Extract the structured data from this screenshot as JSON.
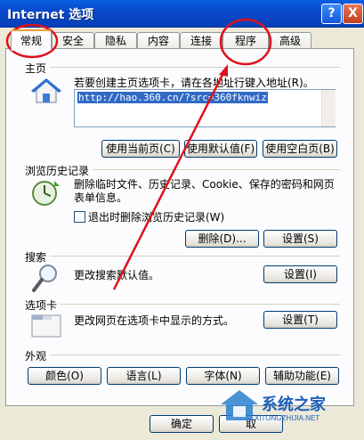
{
  "window": {
    "title": "Internet 选项",
    "help": "?",
    "close": "X"
  },
  "tabs": [
    {
      "label": "常规"
    },
    {
      "label": "安全"
    },
    {
      "label": "隐私"
    },
    {
      "label": "内容"
    },
    {
      "label": "连接"
    },
    {
      "label": "程序"
    },
    {
      "label": "高级"
    }
  ],
  "homepage": {
    "section": "主页",
    "desc": "若要创建主页选项卡，请在各地址行键入地址(R)。",
    "url": "http://hao.360.cn/?src=360fknwiz",
    "use_current": "使用当前页(C)",
    "use_default": "使用默认值(F)",
    "use_blank": "使用空白页(B)"
  },
  "history": {
    "section": "浏览历史记录",
    "desc": "删除临时文件、历史记录、Cookie、保存的密码和网页表单信息。",
    "checkbox": "退出时删除浏览历史记录(W)",
    "delete": "删除(D)...",
    "settings": "设置(S)"
  },
  "search": {
    "section": "搜索",
    "desc": "更改搜索默认值。",
    "settings": "设置(I)"
  },
  "tabs_section": {
    "section": "选项卡",
    "desc": "更改网页在选项卡中显示的方式。",
    "settings": "设置(T)"
  },
  "appearance": {
    "section": "外观",
    "colors": "颜色(O)",
    "languages": "语言(L)",
    "fonts": "字体(N)",
    "accessibility": "辅助功能(E)"
  },
  "footer": {
    "ok": "确定",
    "cancel": "取"
  },
  "watermark": {
    "brand": "系统之家",
    "site": "XITONGZHIJIA.NET"
  },
  "colors": {
    "titlebar": "#0848c9",
    "annotation": "#e0111b"
  }
}
